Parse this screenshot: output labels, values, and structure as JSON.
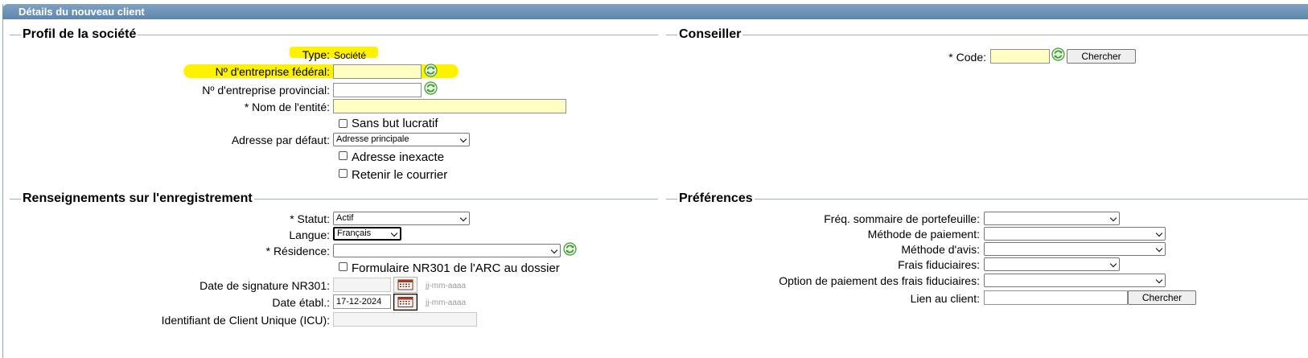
{
  "window": {
    "title": "Détails du nouveau client"
  },
  "profile": {
    "section_title": "Profil de la société",
    "type_label": "Type:",
    "type_value": "Société",
    "federal_label": "Nº d'entreprise fédéral:",
    "federal_value": "",
    "provincial_label": "Nº d'entreprise provincial:",
    "provincial_value": "",
    "entity_label": "* Nom de l'entité:",
    "entity_value": "",
    "nonprofit_label": "Sans but lucratif",
    "address_label": "Adresse par défaut:",
    "address_value": "Adresse principale",
    "bad_address_label": "Adresse inexacte",
    "hold_mail_label": "Retenir le courrier"
  },
  "advisor": {
    "section_title": "Conseiller",
    "code_label": "* Code:",
    "code_value": "",
    "search_label": "Chercher"
  },
  "registration": {
    "section_title": "Renseignements sur l'enregistrement",
    "status_label": "* Statut:",
    "status_value": "Actif",
    "language_label": "Langue:",
    "language_value": "Français",
    "residence_label": "* Résidence:",
    "residence_value": "",
    "nr301_label": "Formulaire NR301 de l'ARC au dossier",
    "nr301_date_label": "Date de signature NR301:",
    "nr301_date_value": "",
    "date_hint": "jj-mm-aaaa",
    "established_label": "Date établ.:",
    "established_value": "17-12-2024",
    "icu_label": "Identifiant de Client Unique (ICU):",
    "icu_value": ""
  },
  "preferences": {
    "section_title": "Préférences",
    "freq_label": "Fréq. sommaire de portefeuille:",
    "freq_value": "",
    "payment_label": "Méthode de paiement:",
    "payment_value": "",
    "notice_label": "Méthode d'avis:",
    "notice_value": "",
    "fees_label": "Frais fiduciaires:",
    "fees_value": "",
    "fees_option_label": "Option de paiement des frais fiduciaires:",
    "fees_option_value": "",
    "client_link_label": "Lien au client:",
    "client_link_value": "",
    "search_label": "Chercher"
  },
  "colors": {
    "highlight": "#fff200",
    "required_bg": "#ffffc4",
    "title_bar": "#6b8fb5"
  }
}
